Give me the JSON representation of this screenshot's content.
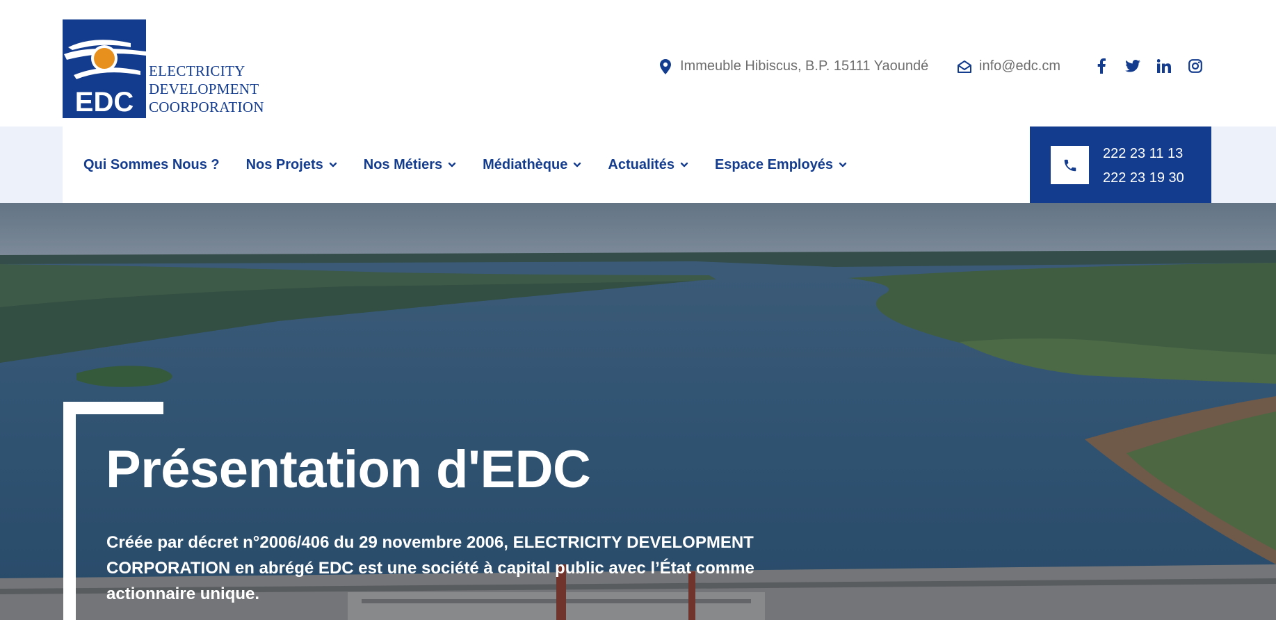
{
  "logo": {
    "mark": "EDC",
    "lines": [
      "ELECTRICITY",
      "DEVELOPMENT",
      "COORPORATION"
    ]
  },
  "contact": {
    "address": "Immeuble Hibiscus, B.P. 15111 Yaoundé",
    "address_icon": "map-pin-icon",
    "email": "info@edc.cm",
    "email_icon": "envelope-open-icon"
  },
  "socials": [
    "facebook-icon",
    "twitter-icon",
    "linkedin-icon",
    "instagram-icon"
  ],
  "nav": {
    "items": [
      {
        "label": "Qui Sommes Nous ?",
        "dropdown": false
      },
      {
        "label": "Nos Projets",
        "dropdown": true
      },
      {
        "label": "Nos Métiers",
        "dropdown": true
      },
      {
        "label": "Médiathèque",
        "dropdown": true
      },
      {
        "label": "Actualités",
        "dropdown": true
      },
      {
        "label": "Espace Employés",
        "dropdown": true
      }
    ]
  },
  "phone": {
    "icon": "phone-icon",
    "numbers": [
      "222 23 11 13",
      "222 23 19 30"
    ]
  },
  "hero": {
    "title": "Présentation d'EDC",
    "description": "Créée par décret n°2006/406 du 29 novembre 2006, ELECTRICITY DEVELOPMENT CORPORATION en abrégé EDC est une société à capital public avec l’État comme actionnaire unique."
  },
  "colors": {
    "brand_blue": "#143c8e",
    "logo_orange": "#e8901d",
    "nav_band": "#edf1f9"
  }
}
